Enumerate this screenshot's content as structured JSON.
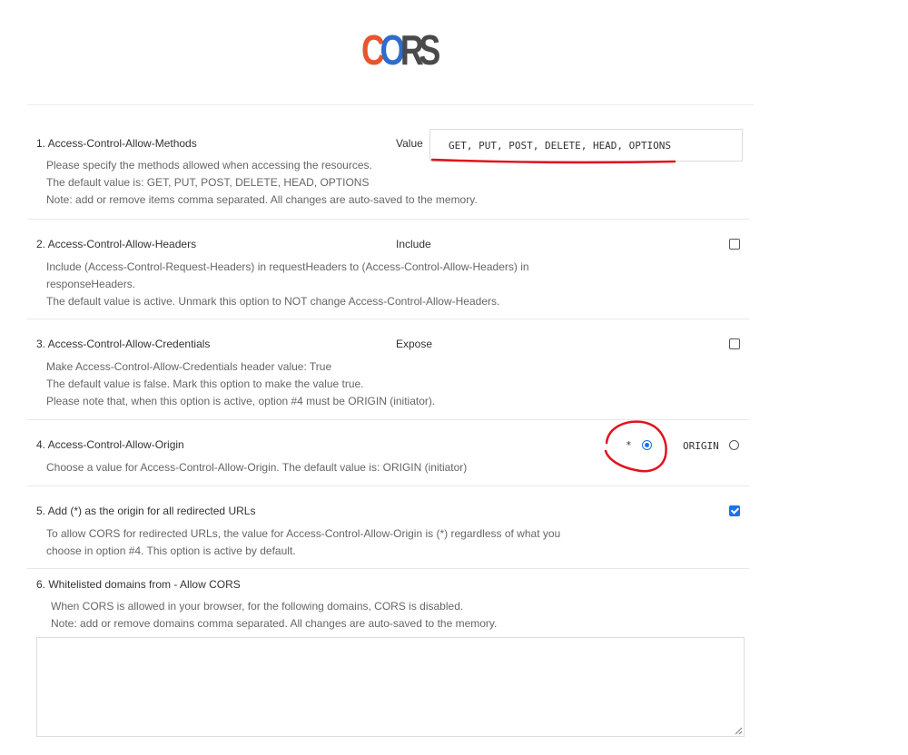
{
  "logo": {
    "l1": "C",
    "l2": "O",
    "l3": "R",
    "l4": "S"
  },
  "sections": {
    "methods": {
      "title": "1. Access-Control-Allow-Methods",
      "label": "Value",
      "value": "GET, PUT, POST, DELETE, HEAD, OPTIONS",
      "desc": [
        "Please specify the methods allowed when accessing the resources.",
        "The default value is: GET, PUT, POST, DELETE, HEAD, OPTIONS",
        "Note: add or remove items comma separated. All changes are auto-saved to the memory."
      ]
    },
    "headers": {
      "title": "2. Access-Control-Allow-Headers",
      "label": "Include",
      "checked": false,
      "desc": [
        "Include (Access-Control-Request-Headers) in requestHeaders to (Access-Control-Allow-Headers) in",
        "responseHeaders.",
        "The default value is active. Unmark this option to NOT change Access-Control-Allow-Headers."
      ]
    },
    "credentials": {
      "title": "3. Access-Control-Allow-Credentials",
      "label": "Expose",
      "checked": false,
      "desc": [
        "Make Access-Control-Allow-Credentials header value: True",
        "The default value is false. Mark this option to make the value true.",
        "Please note that, when this option is active, option #4 must be ORIGIN (initiator)."
      ]
    },
    "origin": {
      "title": "4. Access-Control-Allow-Origin",
      "options": [
        "*",
        "ORIGIN"
      ],
      "selected": "*",
      "desc": [
        "Choose a value for Access-Control-Allow-Origin. The default value is: ORIGIN (initiator)"
      ]
    },
    "redirect": {
      "title": "5. Add (*) as the origin for all redirected URLs",
      "checked": true,
      "desc": [
        "To allow CORS for redirected URLs, the value for Access-Control-Allow-Origin is (*) regardless of what you",
        "choose in option #4. This option is active by default."
      ]
    },
    "whitelist": {
      "title": "6. Whitelisted domains from - Allow CORS",
      "desc": [
        "When CORS is allowed in your browser, for the following domains, CORS is disabled.",
        "Note: add or remove domains comma separated. All changes are auto-saved to the memory."
      ],
      "value": ""
    }
  },
  "colors": {
    "accent": "#1a73e8",
    "annotation": "#e0141e"
  }
}
